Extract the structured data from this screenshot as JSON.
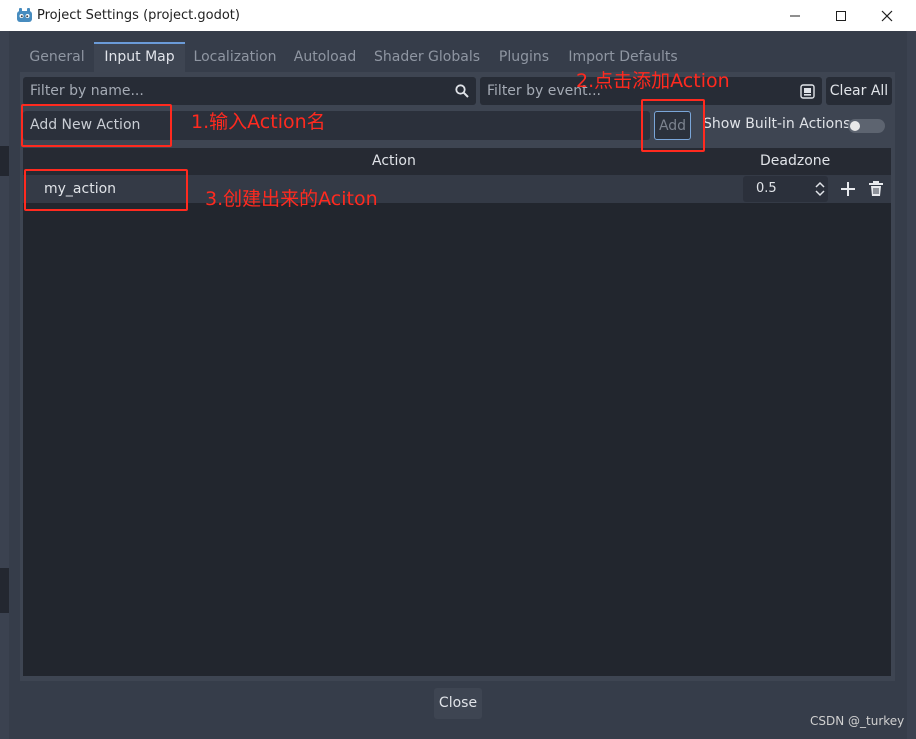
{
  "window": {
    "title": "Project Settings (project.godot)",
    "icon": "godot-icon"
  },
  "tabs": [
    {
      "label": "General",
      "active": false
    },
    {
      "label": "Input Map",
      "active": true
    },
    {
      "label": "Localization",
      "active": false
    },
    {
      "label": "Autoload",
      "active": false
    },
    {
      "label": "Shader Globals",
      "active": false
    },
    {
      "label": "Plugins",
      "active": false
    },
    {
      "label": "Import Defaults",
      "active": false
    }
  ],
  "filters": {
    "name_placeholder": "Filter by name...",
    "event_placeholder": "Filter by event...",
    "clear_all_label": "Clear All"
  },
  "new_action": {
    "placeholder": "Add New Action",
    "add_label": "Add",
    "show_builtin_label": "Show Built-in Actions",
    "show_builtin_on": false
  },
  "table": {
    "headers": {
      "action": "Action",
      "deadzone": "Deadzone"
    },
    "rows": [
      {
        "action": "my_action",
        "deadzone": "0.5"
      }
    ]
  },
  "footer": {
    "close_label": "Close"
  },
  "watermark": "CSDN @_turkey",
  "annotations": [
    {
      "label": "1.输入Action名"
    },
    {
      "label": "2.点击添加Action"
    },
    {
      "label": "3.创建出来的Aciton"
    }
  ],
  "colors": {
    "accent": "#6b9bd8",
    "annotation": "#ff2a1f",
    "panel": "#3e4552",
    "background": "#363d4a"
  }
}
